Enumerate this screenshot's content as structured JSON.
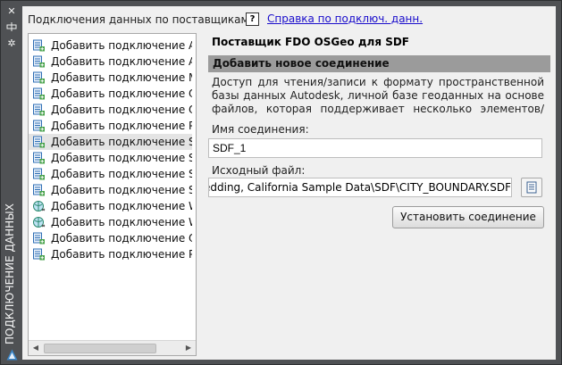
{
  "palette": {
    "title": "ПОДКЛЮЧЕНИЕ ДАННЫХ",
    "strip_icons": [
      "close-icon",
      "pin-icon",
      "settings-icon",
      "autodesk-logo"
    ]
  },
  "header": {
    "label": "Подключения данных по поставщикам",
    "help_icon_text": "?",
    "help_link": "Справка по подключ. данн."
  },
  "providers": {
    "selected_index": 6,
    "items": [
      {
        "label": "Добавить подключение ArcGIS",
        "icon": "arcgis-icon"
      },
      {
        "label": "Добавить подключение ArcSDE",
        "icon": "arcsde-icon"
      },
      {
        "label": "Добавить подключение MySQL",
        "icon": "mysql-icon"
      },
      {
        "label": "Добавить подключение ODBC",
        "icon": "odbc-icon"
      },
      {
        "label": "Добавить подключение Oracle",
        "icon": "oracle-icon"
      },
      {
        "label": "Добавить подключение PostgreSQL",
        "icon": "postgresql-icon"
      },
      {
        "label": "Добавить подключение SDF",
        "icon": "sdf-icon"
      },
      {
        "label": "Добавить подключение SHP",
        "icon": "shp-icon"
      },
      {
        "label": "Добавить подключение SQL Server",
        "icon": "sqlserver-icon"
      },
      {
        "label": "Добавить подключение SQLite",
        "icon": "sqlite-icon"
      },
      {
        "label": "Добавить подключение WFS",
        "icon": "wfs-icon"
      },
      {
        "label": "Добавить подключение WMS",
        "icon": "wms-icon"
      },
      {
        "label": "Добавить подключение Отра",
        "icon": "raster-icon"
      },
      {
        "label": "Добавить подключение Растр",
        "icon": "raster-icon"
      }
    ]
  },
  "details": {
    "provider_title": "Поставщик FDO OSGeo для SDF",
    "section_title": "Добавить новое соединение",
    "description": "Доступ для чтения/записи к формату пространственной базы данных Autodesk, личной базе геоданных на основе файлов, которая поддерживает несколько элементов/атрибутов, простра",
    "name_label": "Имя соединения:",
    "name_value": "SDF_1",
    "source_label": "Исходный файл:",
    "source_value": "ta\\Redding, California Sample Data\\SDF\\CITY_BOUNDARY.SDF",
    "connect_button": "Установить соединение"
  }
}
